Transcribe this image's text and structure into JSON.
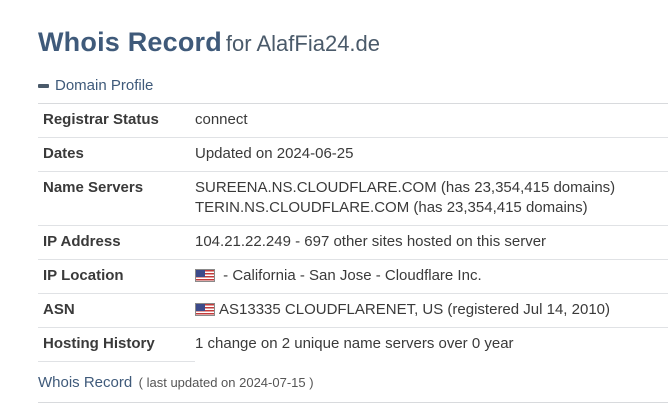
{
  "header": {
    "title": "Whois Record",
    "subtitle": "for AlafFia24.de"
  },
  "section": {
    "toggle_label": "Domain Profile",
    "icon": "minus-icon"
  },
  "profile": {
    "registrar_status": {
      "label": "Registrar Status",
      "value": "connect"
    },
    "dates": {
      "label": "Dates",
      "value": "Updated on 2024-06-25"
    },
    "name_servers": {
      "label": "Name Servers",
      "values": [
        "SUREENA.NS.CLOUDFLARE.COM (has 23,354,415 domains)",
        "TERIN.NS.CLOUDFLARE.COM (has 23,354,415 domains)"
      ]
    },
    "ip_address": {
      "label": "IP Address",
      "value": "104.21.22.249 - 697 other sites hosted on this server"
    },
    "ip_location": {
      "label": "IP Location",
      "value": " - California - San Jose - Cloudflare Inc.",
      "flag": "us-flag-icon"
    },
    "asn": {
      "label": "ASN",
      "value": "AS13335 CLOUDFLARENET, US (registered Jul 14, 2010)",
      "flag": "us-flag-icon"
    },
    "hosting_history": {
      "label": "Hosting History",
      "value": "1 change on 2 unique name servers over 0 year"
    }
  },
  "footer": {
    "link_label": "Whois Record",
    "note": "( last updated on 2024-07-15 )"
  },
  "colors": {
    "title": "#3f5a7a",
    "text": "#3a3a3a",
    "divider": "#e0e2e5"
  }
}
